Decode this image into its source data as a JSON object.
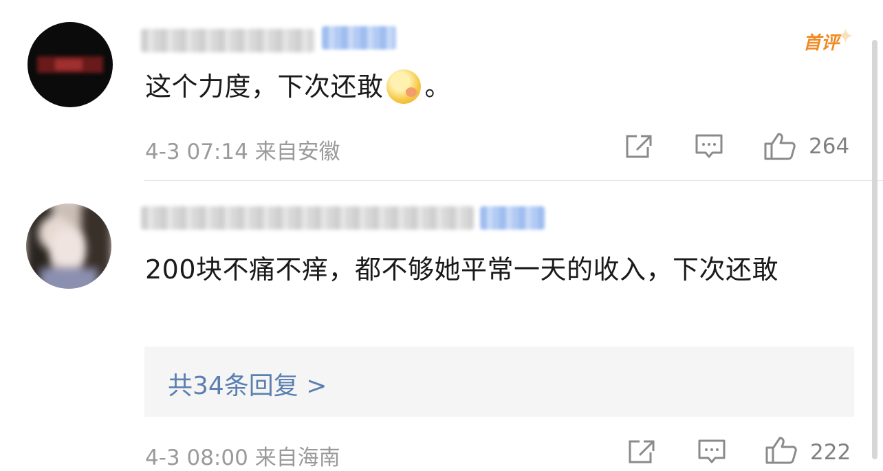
{
  "comments": [
    {
      "is_first": true,
      "first_badge": "首评",
      "text_before": "这个力度，下次还敢",
      "emoji": "wink-face-emoji",
      "text_after": "。",
      "time": "4-3 07:14",
      "location": "来自安徽",
      "likes": "264"
    },
    {
      "text": "200块不痛不痒，都不够她平常一天的收入，下次还敢",
      "replies_label": "共34条回复 >",
      "time": "4-3 08:00",
      "location": "来自海南",
      "likes": "222"
    }
  ],
  "icons": [
    "share-icon",
    "comment-icon",
    "thumbs-up-icon"
  ],
  "colors": {
    "accent_orange": "#f08a24",
    "reply_link": "#5a7fb0",
    "meta_gray": "#9a9a9a"
  }
}
